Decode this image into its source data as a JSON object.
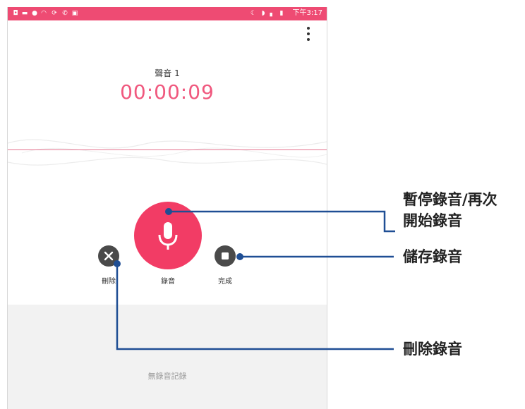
{
  "status_bar": {
    "time": "下午3:17",
    "left_icons": [
      "notification-icon",
      "image-icon",
      "mic-icon",
      "cast-icon",
      "sync-icon",
      "call-icon",
      "gallery-icon"
    ],
    "right_icons": [
      "moon-icon",
      "wifi-icon",
      "sim-icon",
      "battery-icon"
    ],
    "color": "#ee4b73"
  },
  "recording": {
    "name": "聲音 1",
    "elapsed": "00:00:09"
  },
  "controls": {
    "delete_label": "刪除",
    "record_label": "錄音",
    "done_label": "完成"
  },
  "history": {
    "empty_text": "無錄音記錄"
  },
  "callouts": {
    "pause_resume": "暫停錄音/再次\n開始錄音",
    "save": "儲存錄音",
    "delete": "刪除錄音",
    "line_color": "#1f4e94"
  },
  "colors": {
    "accent": "#f23c65",
    "time_text": "#f0587e",
    "button_dark": "#4a4a4a",
    "history_bg": "#f2f2f2"
  }
}
